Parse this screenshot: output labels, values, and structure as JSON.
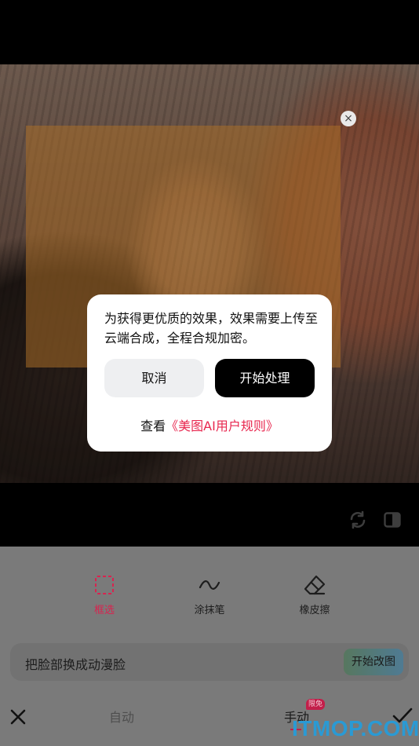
{
  "photo": {
    "close_glyph": "×"
  },
  "tools": [
    {
      "label": "框选",
      "icon": "dashed-box-icon",
      "active": true
    },
    {
      "label": "涂抹笔",
      "icon": "brush-stroke-icon",
      "active": false
    },
    {
      "label": "橡皮擦",
      "icon": "eraser-icon",
      "active": false
    }
  ],
  "prompt": {
    "text": "把脸部换成动漫脸",
    "button": "开始改图"
  },
  "modes": {
    "auto": "自动",
    "manual": "手动",
    "badge": "限免"
  },
  "dialog": {
    "message": "为获得更优质的效果，效果需要上传至云端合成，全程合规加密。",
    "cancel": "取消",
    "confirm": "开始处理",
    "link_prefix": "查看",
    "link_text": "《美图AI用户规则》"
  },
  "watermark": "ITMOP.COM",
  "colors": {
    "accent": "#e8274f",
    "dialog_bg": "#ffffff",
    "overlay": "rgba(0,0,0,0.35)"
  }
}
